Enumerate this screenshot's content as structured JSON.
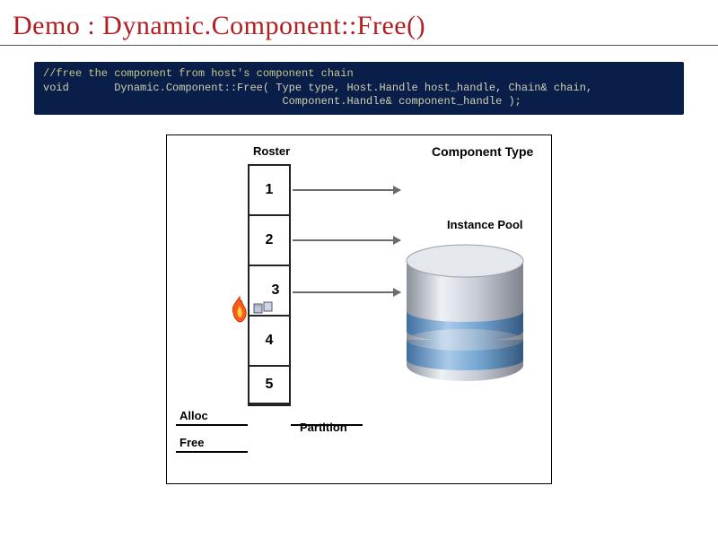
{
  "title": "Demo : Dynamic.Component::Free()",
  "code": {
    "comment": "//free the component from host's component chain",
    "sig1": "void       Dynamic.Component::Free( Type type, Host.Handle host_handle, Chain& chain,",
    "sig2": "                                     Component.Handle& component_handle );"
  },
  "diagram": {
    "roster_label": "Roster",
    "component_type_label": "Component Type",
    "instance_pool_label": "Instance Pool",
    "alloc_label": "Alloc",
    "free_label": "Free",
    "partition_label": "Partition",
    "cells": [
      "1",
      "2",
      "3",
      "4",
      "5"
    ]
  }
}
